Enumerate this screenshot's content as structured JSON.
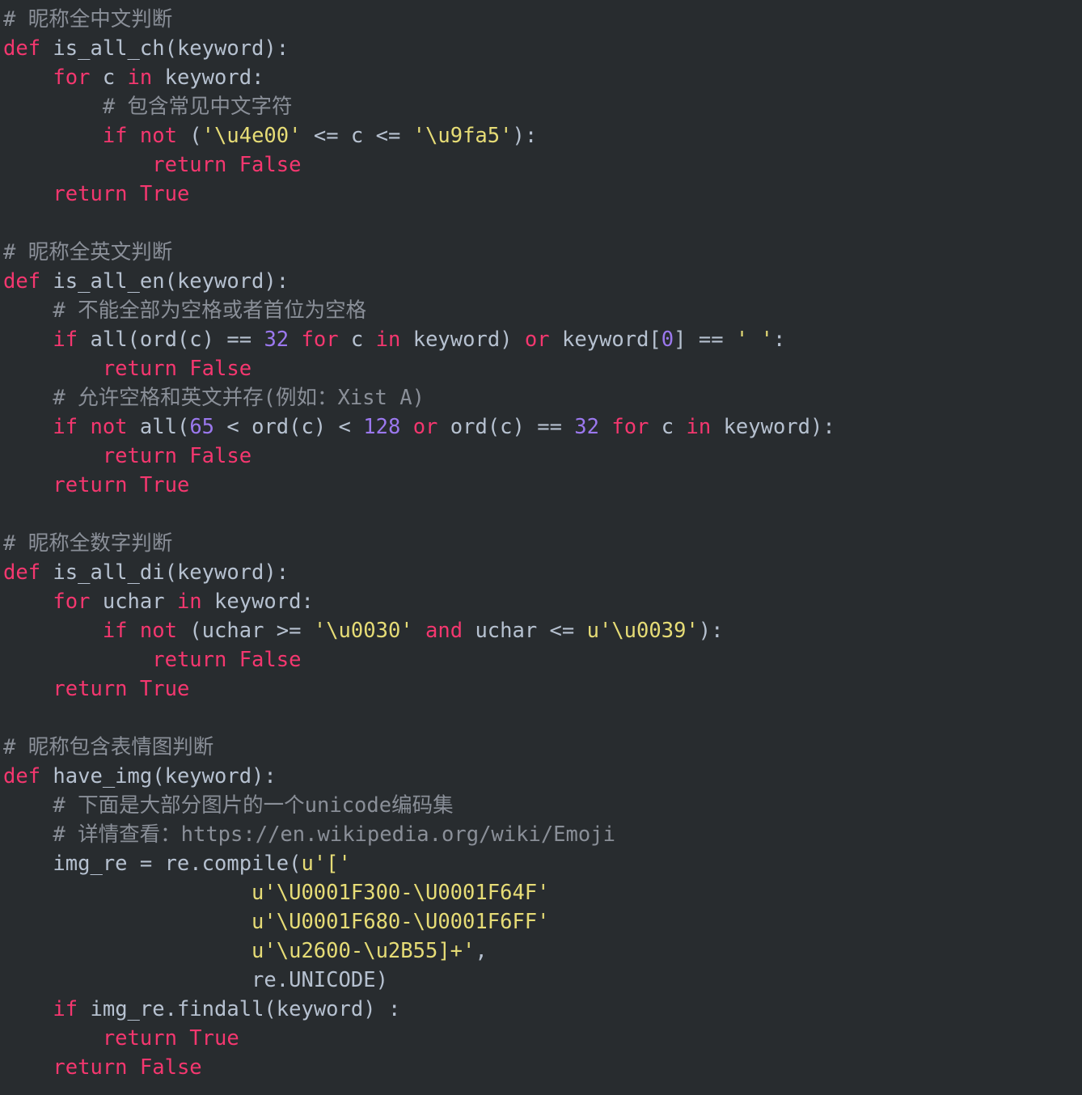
{
  "editor": {
    "language": "Python",
    "theme": "dark-monokai-like",
    "background_color": "#282c2f",
    "colors": {
      "comment": "#8a8f98",
      "keyword": "#f4376f",
      "identifier": "#b6c1d0",
      "string": "#e6dc76",
      "number": "#9b78ee"
    }
  },
  "code": {
    "lines": [
      {
        "n": 1,
        "tokens": [
          {
            "t": "com",
            "v": "# 昵称全中文判断"
          }
        ]
      },
      {
        "n": 2,
        "tokens": [
          {
            "t": "kw",
            "v": "def"
          },
          {
            "t": "id",
            "v": " is_all_ch(keyword):"
          }
        ]
      },
      {
        "n": 3,
        "tokens": [
          {
            "t": "id",
            "v": "    "
          },
          {
            "t": "kw",
            "v": "for"
          },
          {
            "t": "id",
            "v": " c "
          },
          {
            "t": "kw",
            "v": "in"
          },
          {
            "t": "id",
            "v": " keyword:"
          }
        ]
      },
      {
        "n": 4,
        "tokens": [
          {
            "t": "com",
            "v": "        # 包含常见中文字符"
          }
        ]
      },
      {
        "n": 5,
        "tokens": [
          {
            "t": "id",
            "v": "        "
          },
          {
            "t": "kw",
            "v": "if not"
          },
          {
            "t": "id",
            "v": " ("
          },
          {
            "t": "str",
            "v": "'\\u4e00'"
          },
          {
            "t": "id",
            "v": " <= c <= "
          },
          {
            "t": "str",
            "v": "'\\u9fa5'"
          },
          {
            "t": "id",
            "v": "):"
          }
        ]
      },
      {
        "n": 6,
        "tokens": [
          {
            "t": "id",
            "v": "            "
          },
          {
            "t": "kw",
            "v": "return False"
          }
        ]
      },
      {
        "n": 7,
        "tokens": [
          {
            "t": "id",
            "v": "    "
          },
          {
            "t": "kw",
            "v": "return True"
          }
        ]
      },
      {
        "n": 8,
        "tokens": []
      },
      {
        "n": 9,
        "tokens": [
          {
            "t": "com",
            "v": "# 昵称全英文判断"
          }
        ]
      },
      {
        "n": 10,
        "tokens": [
          {
            "t": "kw",
            "v": "def"
          },
          {
            "t": "id",
            "v": " is_all_en(keyword):"
          }
        ]
      },
      {
        "n": 11,
        "tokens": [
          {
            "t": "com",
            "v": "    # 不能全部为空格或者首位为空格"
          }
        ]
      },
      {
        "n": 12,
        "tokens": [
          {
            "t": "id",
            "v": "    "
          },
          {
            "t": "kw",
            "v": "if"
          },
          {
            "t": "id",
            "v": " all(ord(c) == "
          },
          {
            "t": "num",
            "v": "32"
          },
          {
            "t": "id",
            "v": " "
          },
          {
            "t": "kw",
            "v": "for"
          },
          {
            "t": "id",
            "v": " c "
          },
          {
            "t": "kw",
            "v": "in"
          },
          {
            "t": "id",
            "v": " keyword) "
          },
          {
            "t": "kw",
            "v": "or"
          },
          {
            "t": "id",
            "v": " keyword["
          },
          {
            "t": "num",
            "v": "0"
          },
          {
            "t": "id",
            "v": "] == "
          },
          {
            "t": "str",
            "v": "' '"
          },
          {
            "t": "id",
            "v": ":"
          }
        ]
      },
      {
        "n": 13,
        "tokens": [
          {
            "t": "id",
            "v": "        "
          },
          {
            "t": "kw",
            "v": "return False"
          }
        ]
      },
      {
        "n": 14,
        "tokens": [
          {
            "t": "com",
            "v": "    # 允许空格和英文并存(例如：Xist A)"
          }
        ]
      },
      {
        "n": 15,
        "tokens": [
          {
            "t": "id",
            "v": "    "
          },
          {
            "t": "kw",
            "v": "if not"
          },
          {
            "t": "id",
            "v": " all("
          },
          {
            "t": "num",
            "v": "65"
          },
          {
            "t": "id",
            "v": " < ord(c) < "
          },
          {
            "t": "num",
            "v": "128"
          },
          {
            "t": "id",
            "v": " "
          },
          {
            "t": "kw",
            "v": "or"
          },
          {
            "t": "id",
            "v": " ord(c) == "
          },
          {
            "t": "num",
            "v": "32"
          },
          {
            "t": "id",
            "v": " "
          },
          {
            "t": "kw",
            "v": "for"
          },
          {
            "t": "id",
            "v": " c "
          },
          {
            "t": "kw",
            "v": "in"
          },
          {
            "t": "id",
            "v": " keyword):"
          }
        ]
      },
      {
        "n": 16,
        "tokens": [
          {
            "t": "id",
            "v": "        "
          },
          {
            "t": "kw",
            "v": "return False"
          }
        ]
      },
      {
        "n": 17,
        "tokens": [
          {
            "t": "id",
            "v": "    "
          },
          {
            "t": "kw",
            "v": "return True"
          }
        ]
      },
      {
        "n": 18,
        "tokens": []
      },
      {
        "n": 19,
        "tokens": [
          {
            "t": "com",
            "v": "# 昵称全数字判断"
          }
        ]
      },
      {
        "n": 20,
        "tokens": [
          {
            "t": "kw",
            "v": "def"
          },
          {
            "t": "id",
            "v": " is_all_di(keyword):"
          }
        ]
      },
      {
        "n": 21,
        "tokens": [
          {
            "t": "id",
            "v": "    "
          },
          {
            "t": "kw",
            "v": "for"
          },
          {
            "t": "id",
            "v": " uchar "
          },
          {
            "t": "kw",
            "v": "in"
          },
          {
            "t": "id",
            "v": " keyword:"
          }
        ]
      },
      {
        "n": 22,
        "tokens": [
          {
            "t": "id",
            "v": "        "
          },
          {
            "t": "kw",
            "v": "if not"
          },
          {
            "t": "id",
            "v": " (uchar >= "
          },
          {
            "t": "str",
            "v": "'\\u0030'"
          },
          {
            "t": "id",
            "v": " "
          },
          {
            "t": "kw",
            "v": "and"
          },
          {
            "t": "id",
            "v": " uchar <= "
          },
          {
            "t": "str",
            "v": "u'\\u0039'"
          },
          {
            "t": "id",
            "v": "):"
          }
        ]
      },
      {
        "n": 23,
        "tokens": [
          {
            "t": "id",
            "v": "            "
          },
          {
            "t": "kw",
            "v": "return False"
          }
        ]
      },
      {
        "n": 24,
        "tokens": [
          {
            "t": "id",
            "v": "    "
          },
          {
            "t": "kw",
            "v": "return True"
          }
        ]
      },
      {
        "n": 25,
        "tokens": []
      },
      {
        "n": 26,
        "tokens": [
          {
            "t": "com",
            "v": "# 昵称包含表情图判断"
          }
        ]
      },
      {
        "n": 27,
        "tokens": [
          {
            "t": "kw",
            "v": "def"
          },
          {
            "t": "id",
            "v": " have_img(keyword):"
          }
        ]
      },
      {
        "n": 28,
        "tokens": [
          {
            "t": "com",
            "v": "    # 下面是大部分图片的一个unicode编码集"
          }
        ]
      },
      {
        "n": 29,
        "tokens": [
          {
            "t": "com",
            "v": "    # 详情查看：https://en.wikipedia.org/wiki/Emoji"
          }
        ]
      },
      {
        "n": 30,
        "tokens": [
          {
            "t": "id",
            "v": "    img_re = re.compile("
          },
          {
            "t": "str",
            "v": "u'['"
          }
        ]
      },
      {
        "n": 31,
        "tokens": [
          {
            "t": "id",
            "v": "                    "
          },
          {
            "t": "str",
            "v": "u'\\U0001F300-\\U0001F64F'"
          }
        ]
      },
      {
        "n": 32,
        "tokens": [
          {
            "t": "id",
            "v": "                    "
          },
          {
            "t": "str",
            "v": "u'\\U0001F680-\\U0001F6FF'"
          }
        ]
      },
      {
        "n": 33,
        "tokens": [
          {
            "t": "id",
            "v": "                    "
          },
          {
            "t": "str",
            "v": "u'\\u2600-\\u2B55]+'"
          },
          {
            "t": "id",
            "v": ","
          }
        ]
      },
      {
        "n": 34,
        "tokens": [
          {
            "t": "id",
            "v": "                    re.UNICODE)"
          }
        ]
      },
      {
        "n": 35,
        "tokens": [
          {
            "t": "id",
            "v": "    "
          },
          {
            "t": "kw",
            "v": "if"
          },
          {
            "t": "id",
            "v": " img_re.findall(keyword) :"
          }
        ]
      },
      {
        "n": 36,
        "tokens": [
          {
            "t": "id",
            "v": "        "
          },
          {
            "t": "kw",
            "v": "return True"
          }
        ]
      },
      {
        "n": 37,
        "tokens": [
          {
            "t": "id",
            "v": "    "
          },
          {
            "t": "kw",
            "v": "return False"
          }
        ]
      }
    ]
  }
}
